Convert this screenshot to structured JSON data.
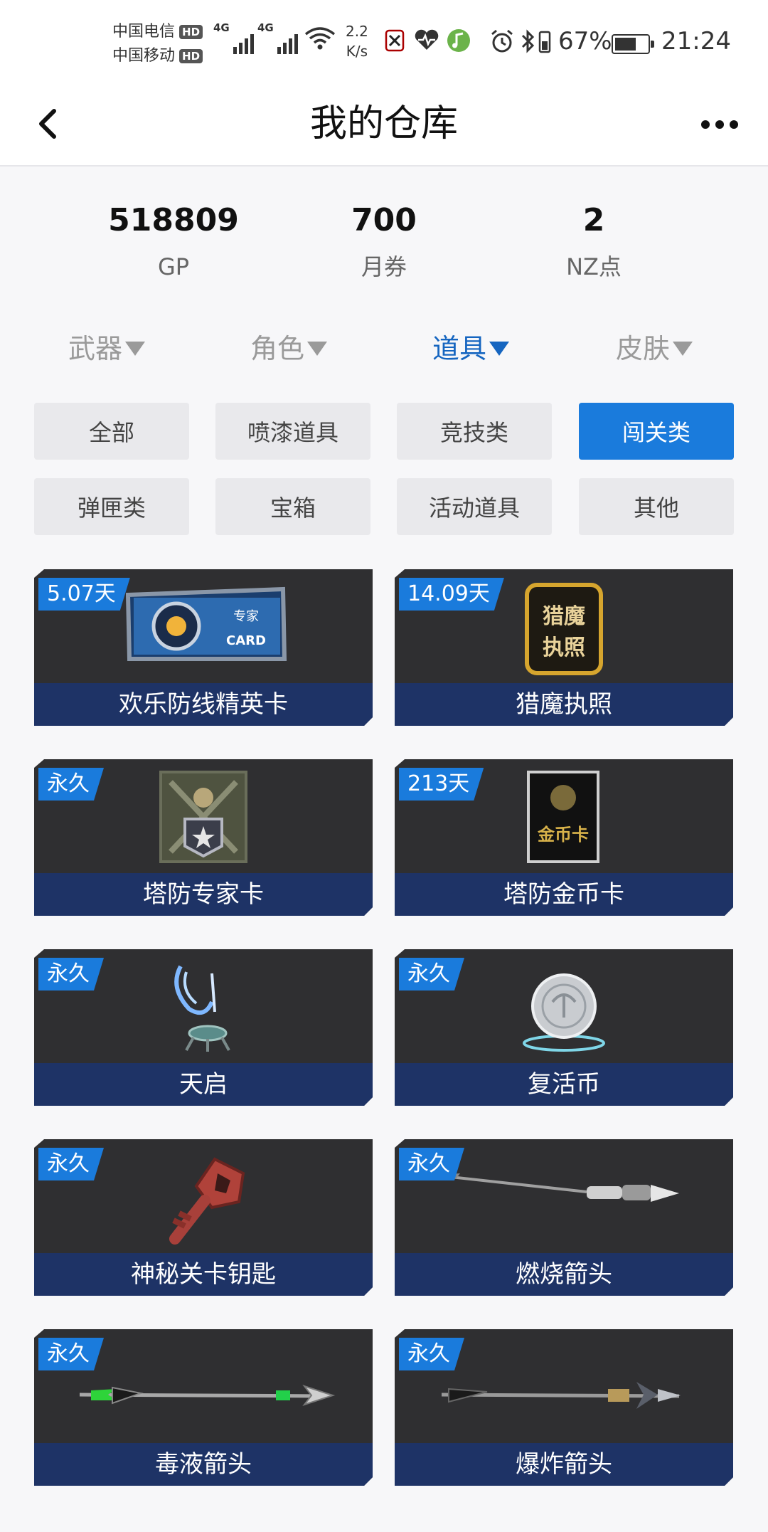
{
  "status_bar": {
    "carrier1": "中国电信",
    "carrier2": "中国移动",
    "hd": "HD",
    "net1": "4G",
    "net2": "4G",
    "speed_value": "2.2",
    "speed_unit": "K/s",
    "battery_pct": "67%",
    "battery_level": 0.67,
    "time": "21:24"
  },
  "header": {
    "title": "我的仓库",
    "back_icon": "chevron-left-icon",
    "more_icon": "more-horizontal-icon"
  },
  "balances": [
    {
      "value": "518809",
      "label": "GP"
    },
    {
      "value": "700",
      "label": "月券"
    },
    {
      "value": "2",
      "label": "NZ点"
    }
  ],
  "categories": [
    {
      "label": "武器",
      "active": false
    },
    {
      "label": "角色",
      "active": false
    },
    {
      "label": "道具",
      "active": true
    },
    {
      "label": "皮肤",
      "active": false
    }
  ],
  "filters": [
    {
      "label": "全部",
      "active": false
    },
    {
      "label": "喷漆道具",
      "active": false
    },
    {
      "label": "竞技类",
      "active": false
    },
    {
      "label": "闯关类",
      "active": true
    },
    {
      "label": "弹匣类",
      "active": false
    },
    {
      "label": "宝箱",
      "active": false
    },
    {
      "label": "活动道具",
      "active": false
    },
    {
      "label": "其他",
      "active": false
    }
  ],
  "items": [
    {
      "name": "欢乐防线精英卡",
      "duration": "5.07天",
      "icon": "elite-card-icon",
      "card_text1": "专家",
      "card_text2": "CARD"
    },
    {
      "name": "猎魔执照",
      "duration": "14.09天",
      "icon": "hunter-license-icon",
      "card_text1": "猎魔",
      "card_text2": "执照"
    },
    {
      "name": "塔防专家卡",
      "duration": "永久",
      "icon": "tower-expert-card-icon"
    },
    {
      "name": "塔防金币卡",
      "duration": "213天",
      "icon": "gold-coin-card-icon",
      "card_text1": "金币卡"
    },
    {
      "name": "天启",
      "duration": "永久",
      "icon": "apocalypse-icon"
    },
    {
      "name": "复活币",
      "duration": "永久",
      "icon": "revive-coin-icon"
    },
    {
      "name": "神秘关卡钥匙",
      "duration": "永久",
      "icon": "key-icon"
    },
    {
      "name": "燃烧箭头",
      "duration": "永久",
      "icon": "burning-arrow-icon"
    },
    {
      "name": "毒液箭头",
      "duration": "永久",
      "icon": "venom-arrow-icon"
    },
    {
      "name": "爆炸箭头",
      "duration": "永久",
      "icon": "explosive-arrow-icon"
    }
  ],
  "colors": {
    "accent": "#1a7bdc",
    "card_bg": "#2f2f31",
    "card_name_bg": "#1e3366"
  }
}
